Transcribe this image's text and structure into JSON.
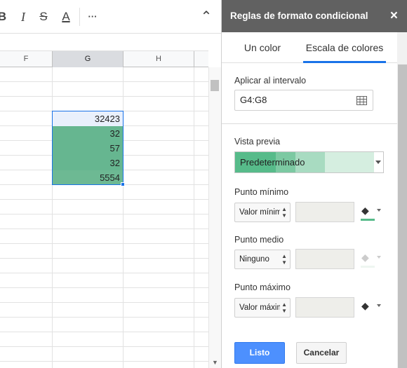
{
  "toolbar": {
    "bold": "B",
    "italic": "I",
    "strikethrough": "S",
    "text_color": "A",
    "more": "···",
    "collapse": "⌃"
  },
  "sheet": {
    "columns": [
      "F",
      "G",
      "H"
    ],
    "selected_column": "G",
    "cells": [
      "32423",
      "32",
      "57",
      "32",
      "5554"
    ]
  },
  "panel": {
    "title": "Reglas de formato condicional",
    "close": "×",
    "tabs": [
      {
        "label": "Un color",
        "active": false
      },
      {
        "label": "Escala de colores",
        "active": true
      }
    ],
    "range_label": "Aplicar al intervalo",
    "range_value": "G4:G8",
    "preview_label": "Vista previa",
    "preview_text": "Predeterminado",
    "min": {
      "label": "Punto mínimo",
      "select": "Valor mínimo",
      "color": "#57bb8a"
    },
    "mid": {
      "label": "Punto medio",
      "select": "Ninguno"
    },
    "max": {
      "label": "Punto máximo",
      "select": "Valor máximo",
      "color": "#ffffff"
    },
    "done_button": "Listo",
    "cancel_button": "Cancelar"
  },
  "colors": {
    "header_bg": "#616161",
    "accent": "#1a73e8",
    "done_button": "#4d90fe",
    "scale_min": "#57bb8a",
    "scale_max": "#ffffff"
  }
}
